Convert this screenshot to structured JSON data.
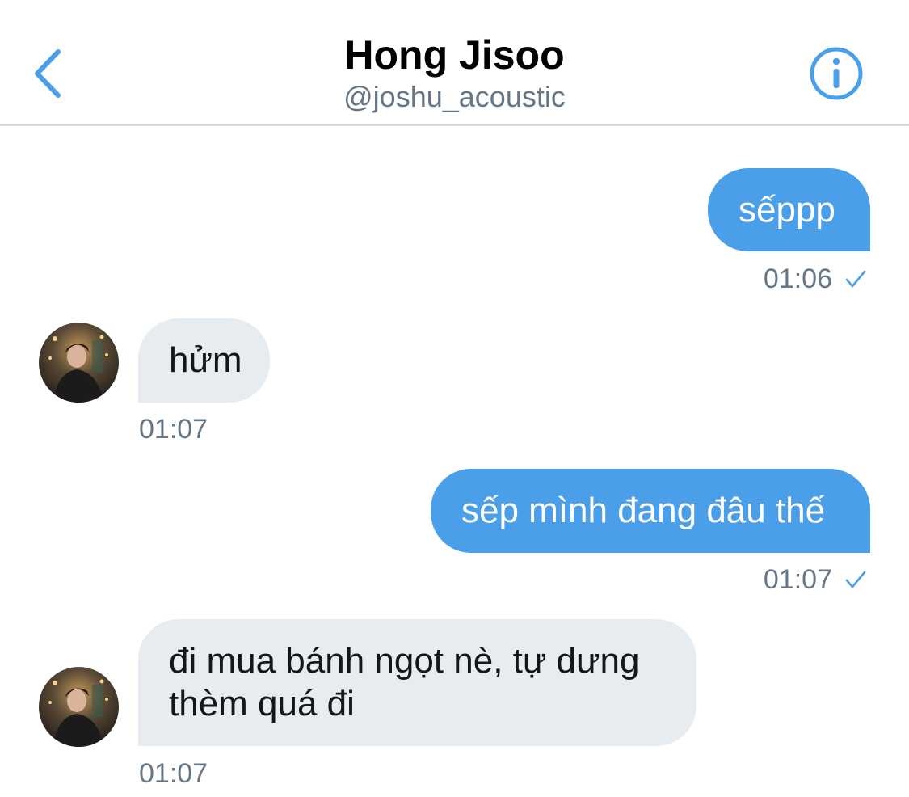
{
  "header": {
    "name": "Hong Jisoo",
    "handle": "@joshu_acoustic",
    "back_icon": "chevron-left-icon",
    "info_icon": "info-icon"
  },
  "colors": {
    "accent": "#4b9fe9",
    "incoming_bubble": "#e6ecf0",
    "meta_text": "#657786",
    "divider": "#d4d8dc"
  },
  "messages": [
    {
      "direction": "outgoing",
      "text": "sếppp",
      "time": "01:06",
      "status_icon": "checkmark-icon"
    },
    {
      "direction": "incoming",
      "text": "hửm",
      "time": "01:07"
    },
    {
      "direction": "outgoing",
      "text": "sếp mình đang đâu thế",
      "time": "01:07",
      "status_icon": "checkmark-icon"
    },
    {
      "direction": "incoming",
      "text": "đi mua bánh ngọt nè, tự dưng\nthèm quá đi",
      "time": "01:07"
    }
  ]
}
